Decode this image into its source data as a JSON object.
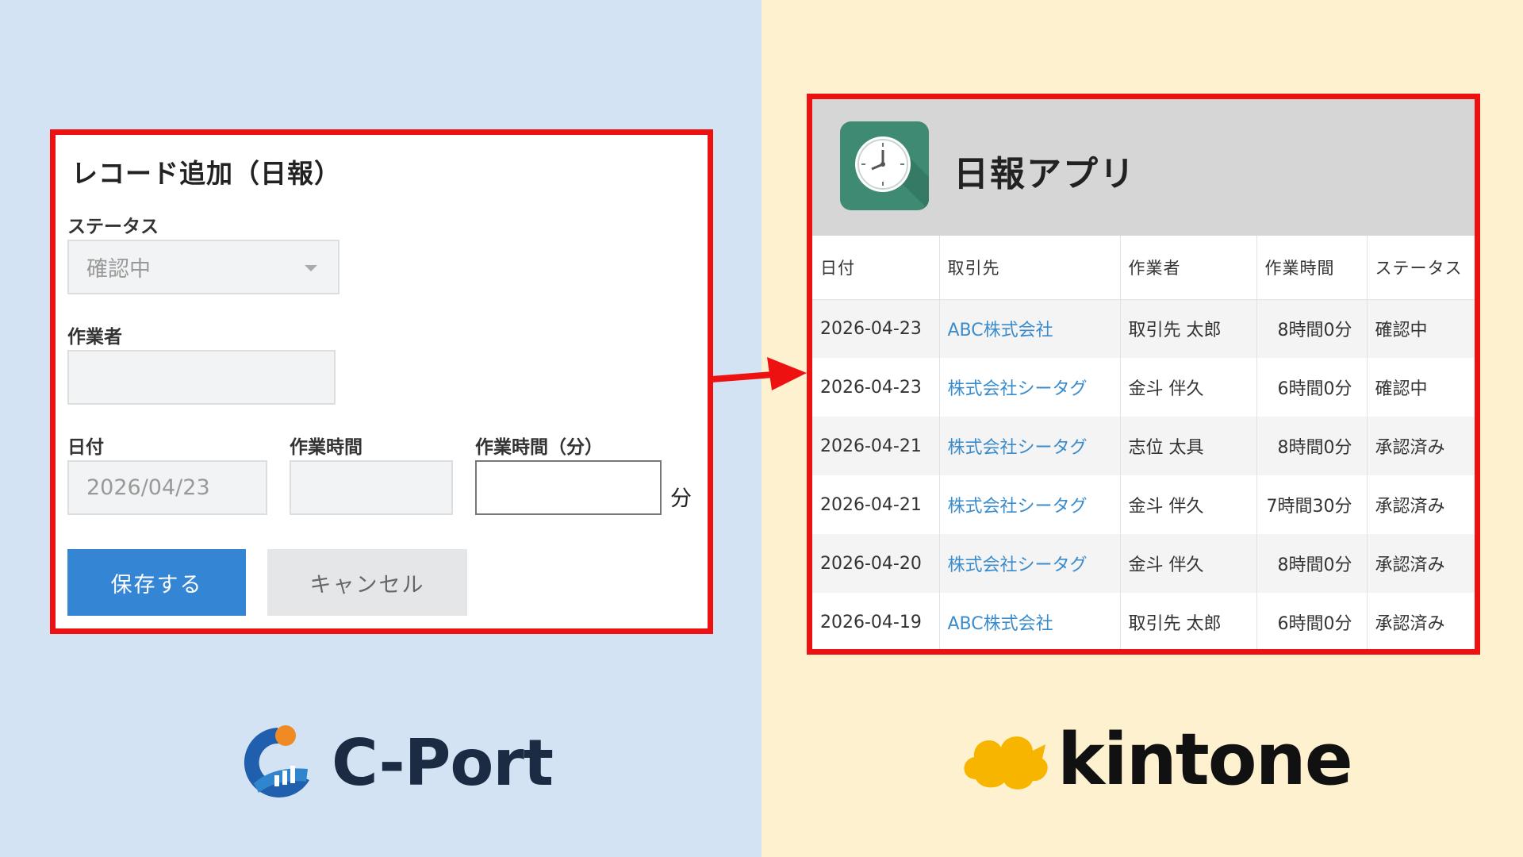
{
  "form": {
    "title": "レコード追加（日報）",
    "status_label": "ステータス",
    "status_value": "確認中",
    "worker_label": "作業者",
    "worker_value": "",
    "date_label": "日付",
    "date_value": "2026/04/23",
    "work_time_label": "作業時間",
    "work_time_value": "",
    "work_minutes_label": "作業時間（分）",
    "work_minutes_value": "",
    "minutes_unit": "分",
    "save_label": "保存する",
    "cancel_label": "キャンセル"
  },
  "app": {
    "title": "日報アプリ",
    "icon": "clock-icon",
    "columns": [
      "日付",
      "取引先",
      "作業者",
      "作業時間",
      "ステータス"
    ],
    "rows": [
      [
        "2026-04-23",
        "ABC株式会社",
        "取引先 太郎",
        "8時間0分",
        "確認中"
      ],
      [
        "2026-04-23",
        "株式会社シータグ",
        "金斗 伴久",
        "6時間0分",
        "確認中"
      ],
      [
        "2026-04-21",
        "株式会社シータグ",
        "志位 太具",
        "8時間0分",
        "承認済み"
      ],
      [
        "2026-04-21",
        "株式会社シータグ",
        "金斗 伴久",
        "7時間30分",
        "承認済み"
      ],
      [
        "2026-04-20",
        "株式会社シータグ",
        "金斗 伴久",
        "8時間0分",
        "承認済み"
      ],
      [
        "2026-04-19",
        "ABC株式会社",
        "取引先 太郎",
        "6時間0分",
        "承認済み"
      ]
    ]
  },
  "logos": {
    "left": "C-Port",
    "right": "kintone"
  },
  "colors": {
    "highlight_border": "#ee1111",
    "save_button": "#3485d4",
    "link": "#3a8ccd",
    "left_bg": "#d4e3f3",
    "right_bg": "#fdf1cf",
    "kintone_cloud": "#f7b500"
  }
}
